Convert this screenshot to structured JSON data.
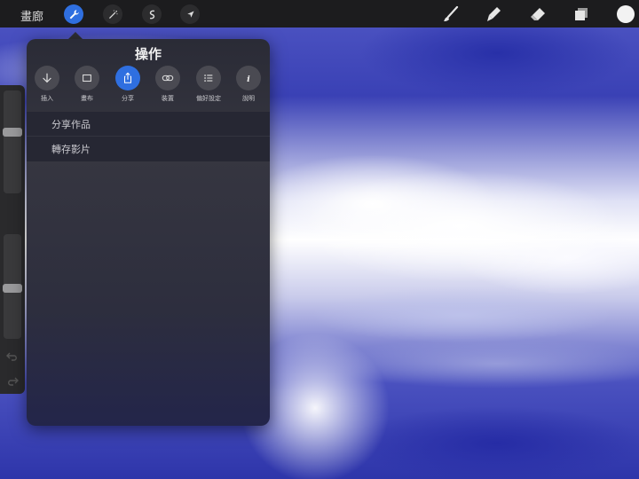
{
  "topbar": {
    "gallery_label": "畫廊"
  },
  "panel": {
    "title": "操作",
    "tabs": [
      {
        "label": "插入",
        "icon": "arrow-down-icon"
      },
      {
        "label": "畫布",
        "icon": "canvas-icon"
      },
      {
        "label": "分享",
        "icon": "share-icon"
      },
      {
        "label": "裝置",
        "icon": "link-icon"
      },
      {
        "label": "偏好設定",
        "icon": "list-icon"
      },
      {
        "label": "說明",
        "icon": "info-icon"
      }
    ],
    "active_tab": "分享",
    "items": [
      {
        "label": "分享作品"
      },
      {
        "label": "轉存影片"
      }
    ]
  },
  "colors": {
    "accent": "#2f6fe0",
    "toolbar_bg": "#1c1c1e",
    "current_color": "#f2f2f2"
  }
}
